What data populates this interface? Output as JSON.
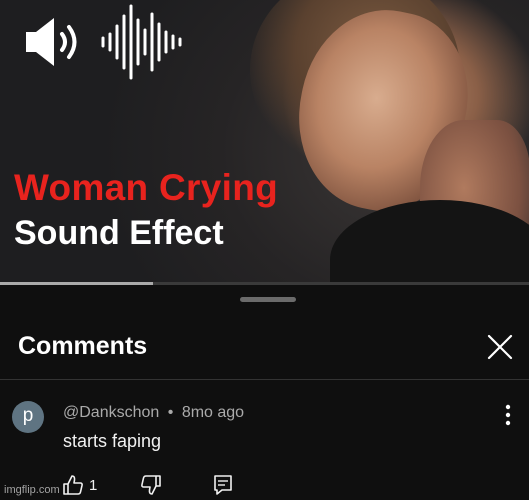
{
  "video": {
    "title_line1": "Woman Crying",
    "title_line2": "Sound Effect",
    "progress_fraction": 0.29
  },
  "comments_sheet": {
    "title": "Comments",
    "comment": {
      "avatar_letter": "p",
      "author": "@Dankschon",
      "separator": "•",
      "age": "8mo ago",
      "text": "starts faping",
      "likes": "1"
    }
  },
  "watermark": "imgflip.com",
  "colors": {
    "title_red": "#e8231e",
    "background": "#0f0f0f",
    "avatar": "#5f7482"
  },
  "icons": [
    "speaker-icon",
    "sound-wave-icon",
    "close-icon",
    "more-vert-icon",
    "thumbs-up-icon",
    "thumbs-down-icon",
    "reply-icon"
  ]
}
